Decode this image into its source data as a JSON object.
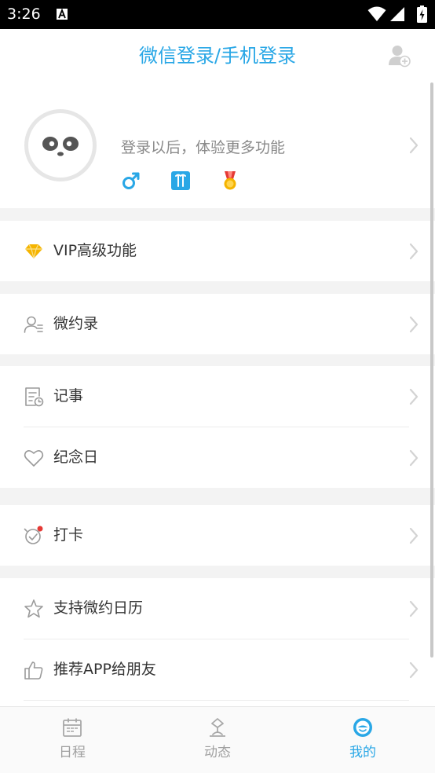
{
  "status_bar": {
    "time": "3:26"
  },
  "header": {
    "title": "微信登录/手机登录",
    "add_user_icon": "add-user-icon"
  },
  "profile": {
    "login_prompt": "登录以后，体验更多功能",
    "badges": [
      "male-symbol-icon",
      "zodiac-icon",
      "medal-icon"
    ]
  },
  "menu": {
    "vip": "VIP高级功能",
    "contacts": "微约录",
    "notes": "记事",
    "anniversary": "纪念日",
    "checkin": "打卡",
    "support": "支持微约日历",
    "recommend": "推荐APP给朋友"
  },
  "tabs": [
    {
      "label": "日程",
      "icon": "calendar-icon",
      "active": false
    },
    {
      "label": "动态",
      "icon": "feed-icon",
      "active": false
    },
    {
      "label": "我的",
      "icon": "profile-face-icon",
      "active": true
    }
  ],
  "colors": {
    "accent": "#29a7e6",
    "background": "#f3f3f3",
    "vip_gold": "#f5b400",
    "notify_red": "#e53935"
  }
}
